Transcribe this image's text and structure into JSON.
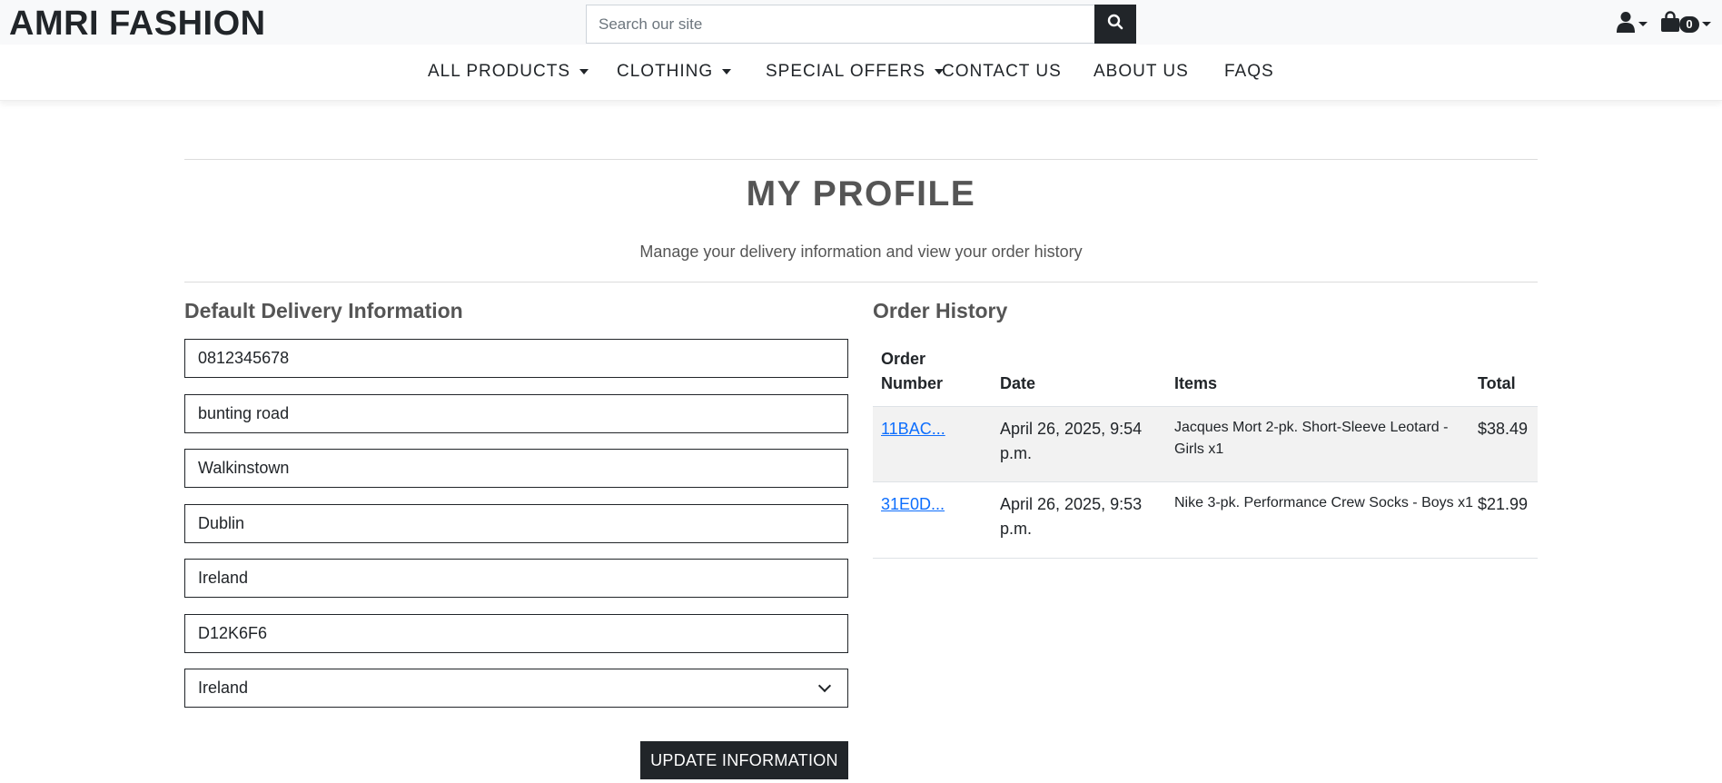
{
  "brand": {
    "part1": "AMRI",
    "part2": "FASHION"
  },
  "search": {
    "placeholder": "Search our site",
    "icon": "search-icon"
  },
  "header_icons": {
    "account_icon": "user-icon",
    "bag_icon": "shopping-bag-icon",
    "bag_count": "0"
  },
  "nav": {
    "items": [
      {
        "label": "ALL PRODUCTS",
        "dropdown": true
      },
      {
        "label": "CLOTHING",
        "dropdown": true
      },
      {
        "label": "SPECIAL OFFERS",
        "dropdown": true
      },
      {
        "label": "CONTACT US",
        "dropdown": false
      },
      {
        "label": "ABOUT US",
        "dropdown": false
      },
      {
        "label": "FAQS",
        "dropdown": false
      }
    ]
  },
  "page": {
    "title": "MY PROFILE",
    "subtitle": "Manage your delivery information and view your order history"
  },
  "delivery": {
    "heading": "Default Delivery Information",
    "phone": "0812345678",
    "street1": "bunting road",
    "street2": "Walkinstown",
    "town": "Dublin",
    "county": "Ireland",
    "postcode": "D12K6F6",
    "country": "Ireland",
    "button_label": "UPDATE INFORMATION"
  },
  "orders": {
    "heading": "Order History",
    "columns": {
      "order_line1": "Order",
      "order_line2": "Number",
      "date": "Date",
      "items": "Items",
      "total": "Total"
    },
    "rows": [
      {
        "number": "11BAC...",
        "date_line1": "April 26, 2025, 9:54",
        "date_line2": "p.m.",
        "items_line1": "Jacques Mort 2-pk. Short-Sleeve Leotard -",
        "items_line2": "Girls x1",
        "total": "$38.49"
      },
      {
        "number": "31E0D...",
        "date_line1": "April 26, 2025, 9:53",
        "date_line2": "p.m.",
        "items_line1": "Nike 3-pk. Performance Crew Socks - Boys x1",
        "items_line2": "",
        "total": "$21.99"
      }
    ]
  },
  "colors": {
    "dark": "#212529",
    "link": "#0d6efd",
    "muted_heading": "#555555",
    "stripe": "#f2f2f2"
  }
}
